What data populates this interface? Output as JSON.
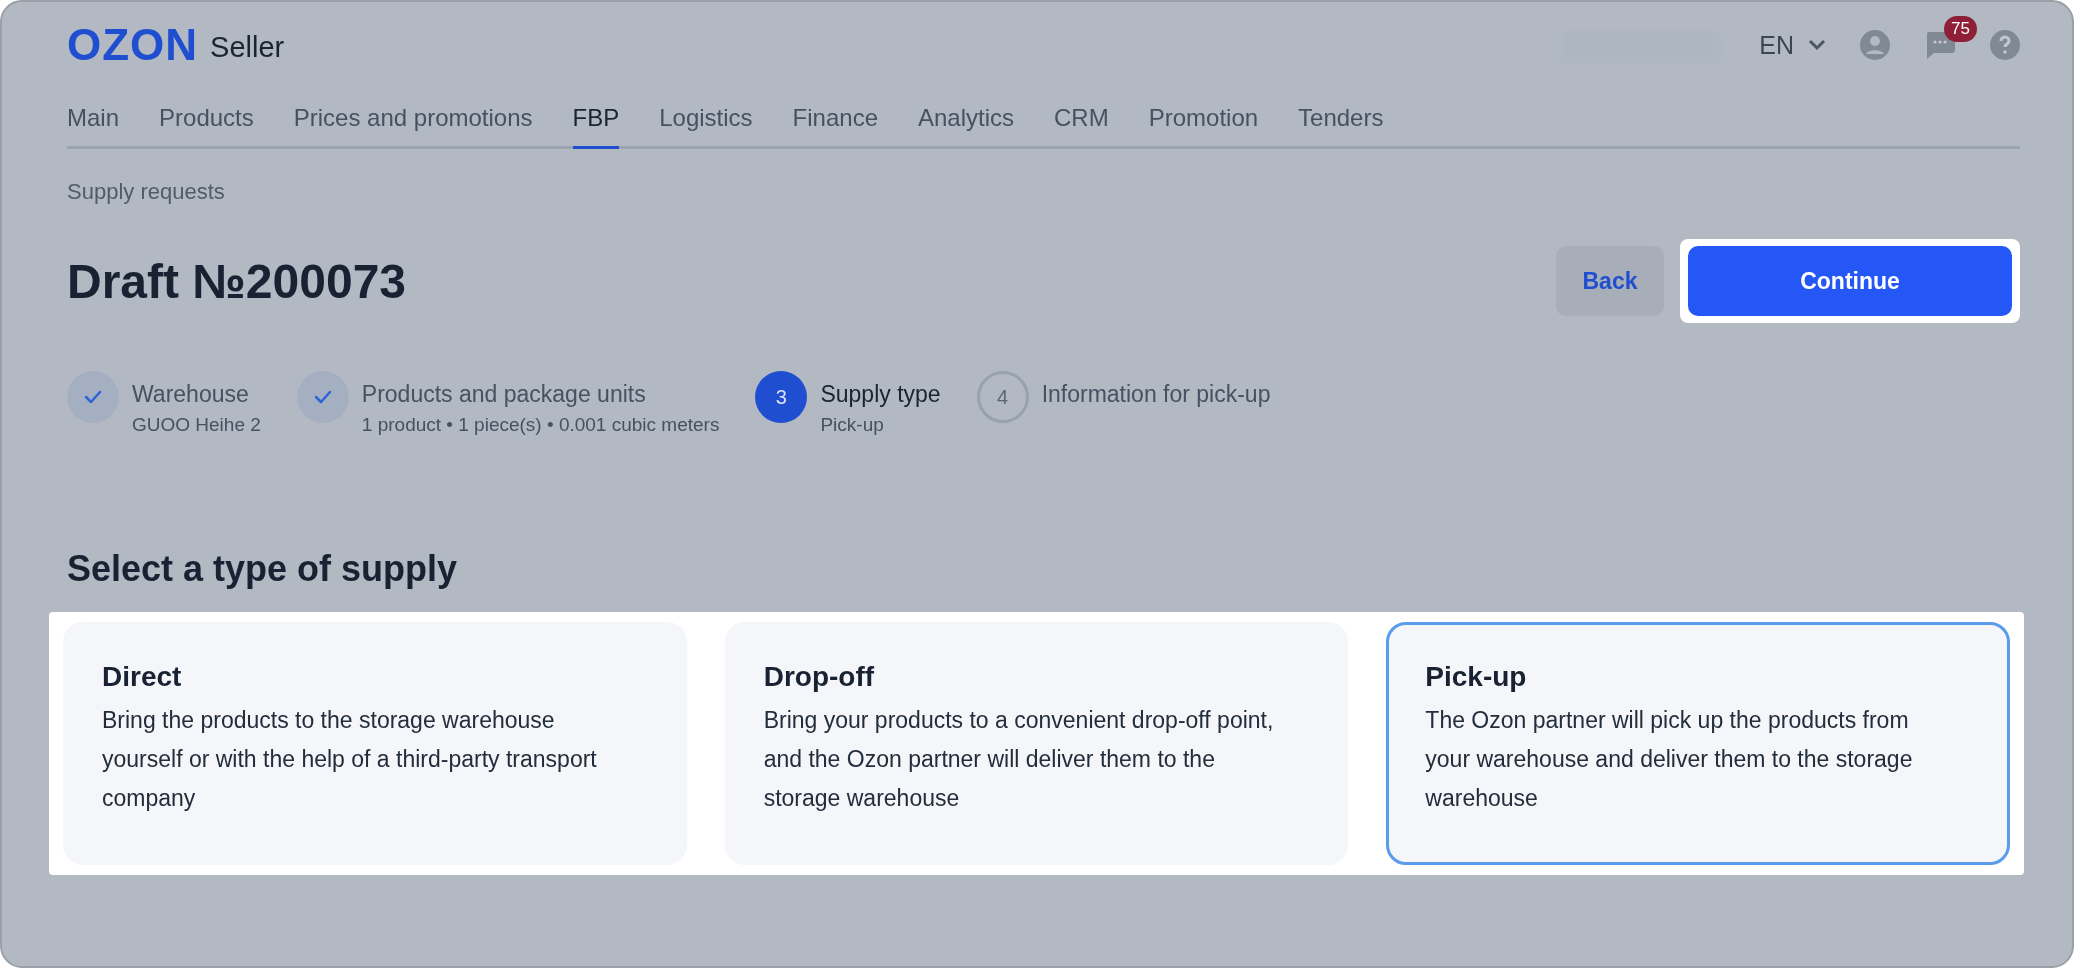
{
  "header": {
    "logo": "OZON",
    "logo_suffix": "Seller",
    "language": "EN",
    "notifications_count": "75"
  },
  "nav": [
    {
      "label": "Main",
      "selected": false
    },
    {
      "label": "Products",
      "selected": false
    },
    {
      "label": "Prices and promotions",
      "selected": false
    },
    {
      "label": "FBP",
      "selected": true
    },
    {
      "label": "Logistics",
      "selected": false
    },
    {
      "label": "Finance",
      "selected": false
    },
    {
      "label": "Analytics",
      "selected": false
    },
    {
      "label": "CRM",
      "selected": false
    },
    {
      "label": "Promotion",
      "selected": false
    },
    {
      "label": "Tenders",
      "selected": false
    }
  ],
  "breadcrumb": "Supply requests",
  "title": "Draft №200073",
  "buttons": {
    "back": "Back",
    "continue": "Continue"
  },
  "steps": [
    {
      "kind": "done",
      "title": "Warehouse",
      "subtitle": "GUOO Heihe 2"
    },
    {
      "kind": "done",
      "title": "Products and package units",
      "subtitle": "1 product • 1 piece(s) • 0.001 cubic meters"
    },
    {
      "kind": "current",
      "number": "3",
      "title": "Supply type",
      "subtitle": "Pick-up"
    },
    {
      "kind": "pending",
      "number": "4",
      "title": "Information for pick-up"
    }
  ],
  "section_title": "Select a type of supply",
  "options": [
    {
      "title": "Direct",
      "description": "Bring the products to the storage warehouse yourself or with the help of a third-party transport company",
      "selected": false
    },
    {
      "title": "Drop-off",
      "description": "Bring your products to a convenient drop-off point, and the Ozon partner will deliver them to the storage warehouse",
      "selected": false
    },
    {
      "title": "Pick-up",
      "description": "The Ozon partner will pick up the products from your warehouse and deliver them to the storage warehouse",
      "selected": true
    }
  ]
}
